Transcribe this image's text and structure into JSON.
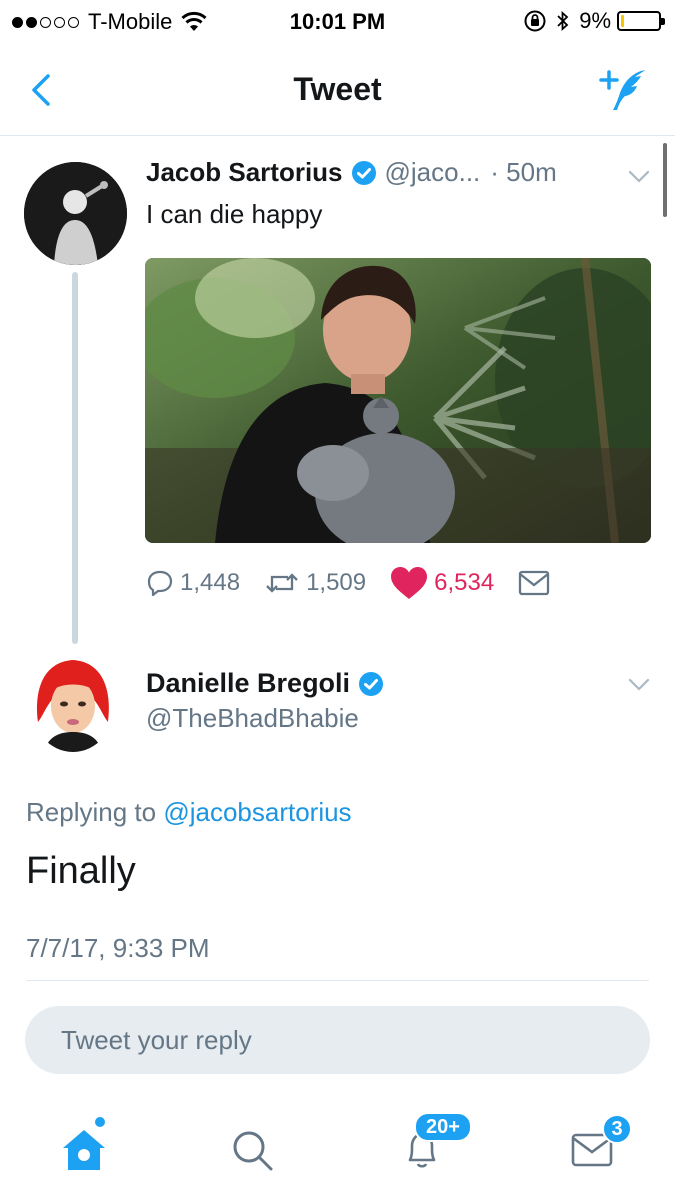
{
  "status_bar": {
    "carrier": "T-Mobile",
    "time": "10:01 PM",
    "battery": "9%",
    "battery_level": 0.09
  },
  "nav": {
    "title": "Tweet"
  },
  "tweet": {
    "name": "Jacob Sartorius",
    "handle": "@jaco...",
    "time": "· 50m",
    "text": "I can die happy",
    "replies": "1,448",
    "retweets": "1,509",
    "likes": "6,534"
  },
  "reply_tweet": {
    "name": "Danielle Bregoli",
    "handle": "@TheBhadBhabie",
    "replying_prefix": "Replying to",
    "replying_to": "@jacobsartorius",
    "text": "Finally",
    "date": "7/7/17, 9:33 PM"
  },
  "reply_input": {
    "placeholder": "Tweet your reply"
  },
  "tab_bar": {
    "notifications_badge": "20+",
    "messages_badge": "3"
  },
  "colors": {
    "accent": "#1da1f2",
    "like": "#e0245e",
    "secondary_text": "#657786"
  }
}
